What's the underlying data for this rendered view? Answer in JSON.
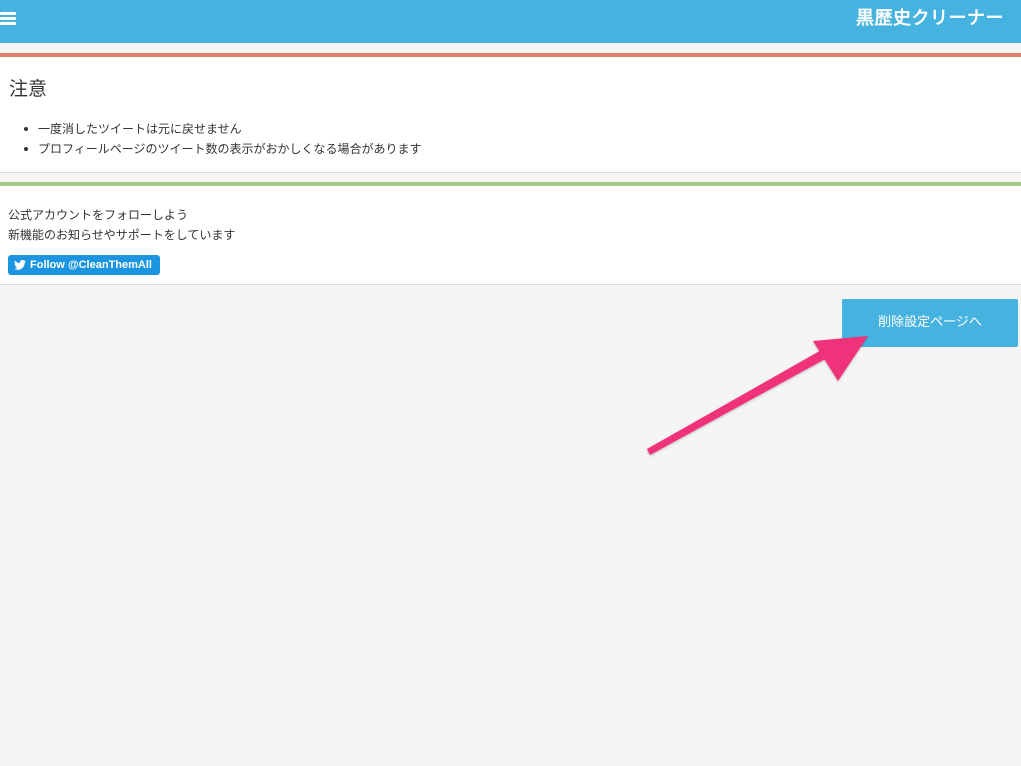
{
  "header": {
    "title": "黒歴史クリーナー",
    "menu_icon": "hamburger-menu-icon",
    "background": "#46b2e0"
  },
  "warning": {
    "title": "注意",
    "items": [
      "一度消したツイートは元に戻せません",
      "プロフィールページのツイート数の表示がおかしくなる場合があります"
    ],
    "accent": "#e3826f"
  },
  "follow": {
    "line1": "公式アカウントをフォローしよう",
    "line2": "新機能のお知らせやサポートをしています",
    "button_label": "Follow @CleanThemAll",
    "button_icon": "twitter-bird-icon",
    "accent": "#a3cb85"
  },
  "main": {
    "settings_button_label": "削除設定ページへ",
    "annotation_color": "#f0307a"
  }
}
